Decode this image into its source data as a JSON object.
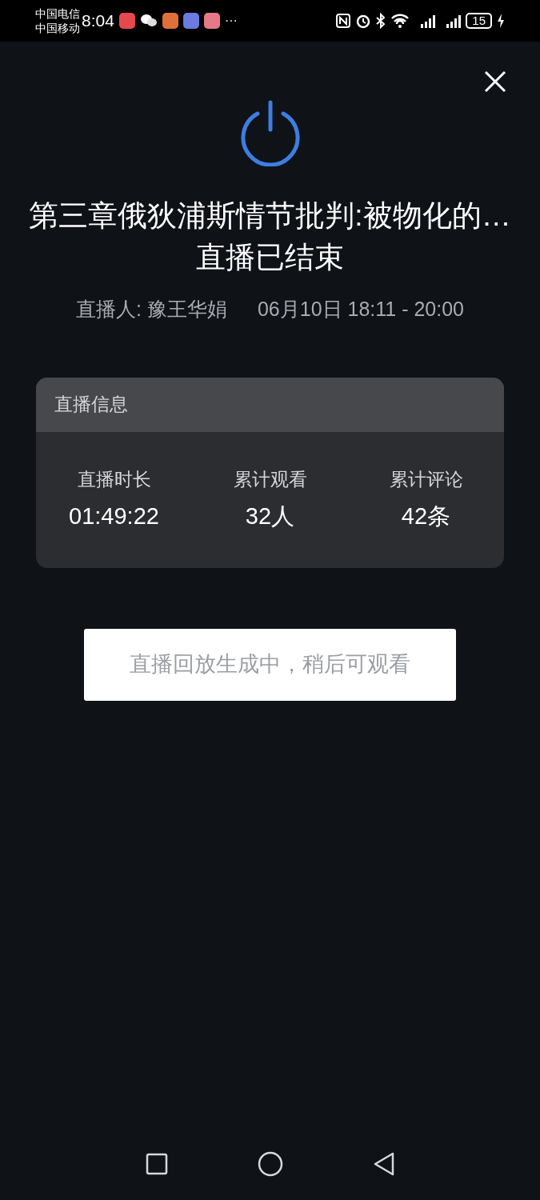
{
  "status_bar": {
    "carriers": [
      "中国电信",
      "中国移动"
    ],
    "time": "8:04",
    "more": "···",
    "battery": "15"
  },
  "title": "第三章俄狄浦斯情节批判:被物化的…",
  "subtitle": "直播已结束",
  "host": "直播人: 豫王华娟",
  "schedule": "06月10日 18:11 - 20:00",
  "info_card": {
    "heading": "直播信息",
    "stats": [
      {
        "label": "直播时长",
        "value": "01:49:22"
      },
      {
        "label": "累计观看",
        "value": "32人"
      },
      {
        "label": "累计评论",
        "value": "42条"
      }
    ]
  },
  "replay_button": {
    "label": "直播回放生成中，稍后可观看",
    "disabled": true
  }
}
